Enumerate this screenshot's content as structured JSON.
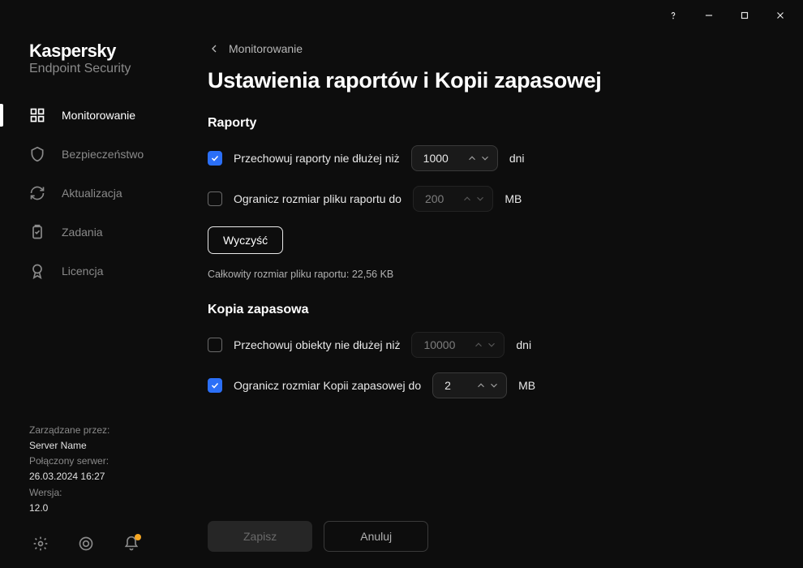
{
  "brand": {
    "title": "Kaspersky",
    "subtitle": "Endpoint Security"
  },
  "nav": {
    "monitoring": "Monitorowanie",
    "security": "Bezpieczeństwo",
    "update": "Aktualizacja",
    "tasks": "Zadania",
    "license": "Licencja"
  },
  "sidebar_footer": {
    "managed_by_label": "Zarządzane przez:",
    "managed_by_value": "Server Name",
    "connected_label": "Połączony serwer:",
    "connected_value": "26.03.2024 16:27",
    "version_label": "Wersja:",
    "version_value": "12.0"
  },
  "breadcrumb": "Monitorowanie",
  "page_title": "Ustawienia raportów i Kopii zapasowej",
  "reports": {
    "section_title": "Raporty",
    "store_label": "Przechowuj raporty nie dłużej niż",
    "store_checked": true,
    "store_value": "1000",
    "store_unit": "dni",
    "limit_label": "Ogranicz rozmiar pliku raportu do",
    "limit_checked": false,
    "limit_value": "200",
    "limit_unit": "MB",
    "clear_button": "Wyczyść",
    "total_size_text": "Całkowity rozmiar pliku raportu: 22,56 KB"
  },
  "backup": {
    "section_title": "Kopia zapasowa",
    "store_label": "Przechowuj obiekty nie dłużej niż",
    "store_checked": false,
    "store_value": "10000",
    "store_unit": "dni",
    "limit_label": "Ogranicz rozmiar Kopii zapasowej do",
    "limit_checked": true,
    "limit_value": "2",
    "limit_unit": "MB"
  },
  "footer": {
    "save": "Zapisz",
    "cancel": "Anuluj"
  }
}
